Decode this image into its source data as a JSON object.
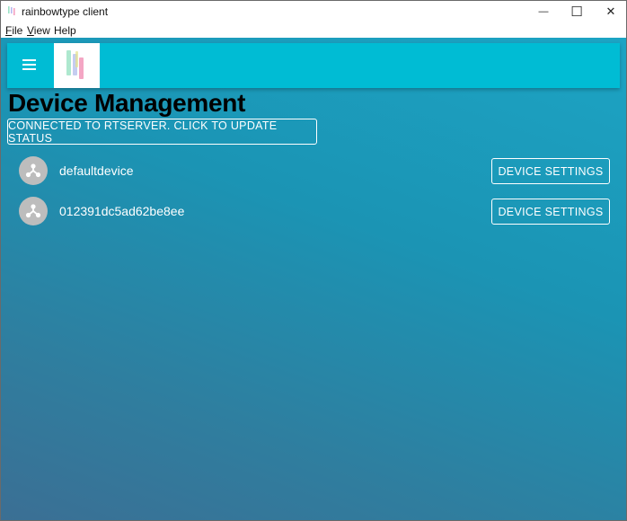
{
  "window": {
    "title": "rainbowtype client",
    "minimize_glyph": "—",
    "maximize_glyph": "☐",
    "close_glyph": "✕"
  },
  "menubar": {
    "items": [
      {
        "label": "File",
        "mnemonic": "F",
        "rest": "ile"
      },
      {
        "label": "View",
        "mnemonic": "V",
        "rest": "iew"
      },
      {
        "label": "Help",
        "mnemonic": "",
        "rest": "Help"
      }
    ]
  },
  "appbar": {
    "menu_icon": "hamburger-menu-icon",
    "logo_icon": "rainbowtype-logo",
    "background": "#00bcd4"
  },
  "page": {
    "title": "Device Management",
    "status_button": "CONNECTED TO RTSERVER. CLICK TO UPDATE STATUS"
  },
  "devices": [
    {
      "name": "defaultdevice",
      "icon": "device-hub-icon",
      "settings_label": "DEVICE SETTINGS"
    },
    {
      "name": "012391dc5ad62be8ee",
      "icon": "device-hub-icon",
      "settings_label": "DEVICE SETTINGS"
    }
  ],
  "colors": {
    "background_top": "#1ca4c4",
    "background_bottom": "#3b6f94",
    "avatar": "#bdbdbd"
  }
}
